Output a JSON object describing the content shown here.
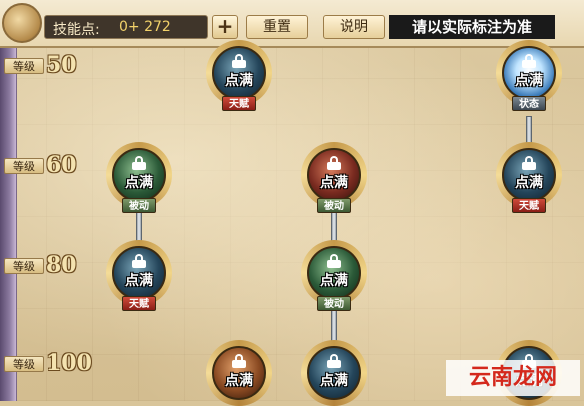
{
  "top_bar": {
    "skill_points_label": "技能点:",
    "skill_points_value": "0+ 272",
    "add_button_label": "+",
    "reset_button_label": "重置",
    "help_button_label": "说明",
    "notice": "请以实际标注为准"
  },
  "levels": [
    {
      "label": "等级",
      "value": "50"
    },
    {
      "label": "等级",
      "value": "60"
    },
    {
      "label": "等级",
      "value": "80"
    },
    {
      "label": "等级",
      "value": "100"
    }
  ],
  "nodes": [
    {
      "status": "点满",
      "tag": "天赋",
      "orb": "blue"
    },
    {
      "status": "点满",
      "tag": "状态",
      "orb": "white"
    },
    {
      "status": "点满",
      "tag": "被动",
      "orb": "green"
    },
    {
      "status": "点满",
      "tag": "被动",
      "orb": "red"
    },
    {
      "status": "点满",
      "tag": "天赋",
      "orb": "blue"
    },
    {
      "status": "点满",
      "tag": "天赋",
      "orb": "blue"
    },
    {
      "status": "点满",
      "tag": "被动",
      "orb": "green"
    },
    {
      "status": "点满",
      "tag": "",
      "orb": "bronze"
    },
    {
      "status": "点满",
      "tag": "",
      "orb": "blue"
    },
    {
      "status": "点满",
      "tag": "",
      "orb": "blue"
    }
  ],
  "watermark": "云南龙网",
  "colors": {
    "tag_talent": "#b02a1e",
    "tag_passive": "#5a7a48",
    "tag_status": "#5a6670",
    "accent_gold": "#f2d26a"
  }
}
